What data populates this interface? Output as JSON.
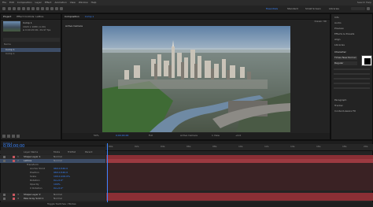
{
  "menu": {
    "items": [
      "File",
      "Edit",
      "Composition",
      "Layer",
      "Effect",
      "Animation",
      "View",
      "Window",
      "Help"
    ],
    "right": [
      "Search Help"
    ]
  },
  "workspaces": [
    "Essentials",
    "Standard",
    "Small Screen",
    "Libraries"
  ],
  "project": {
    "tab": "Project",
    "tab2": "Effect Controls: Lattice",
    "item_name": "Comp 1",
    "item_meta": "1920 x 1080 (1.00)",
    "item_meta2": "Δ 0:00:20:00, 29.97 fps",
    "columns": [
      "Name"
    ],
    "rows": [
      "Comp 1",
      "Comp 1"
    ]
  },
  "composition": {
    "tab": "Composition",
    "tab_name": "Comp 1",
    "view_label": "Active Camera",
    "renderer": "Classic 3D",
    "footer": [
      "50%",
      "0;00;00;00",
      "Full",
      "Active Camera",
      "1 View",
      "+0.0"
    ]
  },
  "right_panel": {
    "items": [
      "Info",
      "Audio",
      "Preview",
      "Effects & Presets",
      "Align",
      "Libraries",
      "Character",
      "Paragraph",
      "Tracker",
      "Content-Aware Fill"
    ],
    "font": "Times New Roman",
    "style": "Regular"
  },
  "timeline": {
    "tab": "Comp 1",
    "timecode": "0;00;00;00",
    "columns": [
      "Layer Name",
      "Mode",
      "TrkMat",
      "Parent"
    ],
    "layers": [
      {
        "num": "1",
        "name": "Shape Layer 1",
        "mode": "Normal"
      },
      {
        "num": "2",
        "name": "Lattice",
        "mode": "Normal"
      },
      {
        "num": "",
        "name": "Transform",
        "mode": ""
      },
      {
        "num": "",
        "name": "Anchor Point",
        "mode": "960.0,540.0"
      },
      {
        "num": "",
        "name": "Position",
        "mode": "960.0,540.0"
      },
      {
        "num": "",
        "name": "Scale",
        "mode": "100.0,100.0%"
      },
      {
        "num": "",
        "name": "Rotation",
        "mode": "0x+0.0°"
      },
      {
        "num": "",
        "name": "Opacity",
        "mode": "100%"
      },
      {
        "num": "",
        "name": "X Rotation",
        "mode": "0x+0.0°"
      },
      {
        "num": "3",
        "name": "Shape Layer 2",
        "mode": "Normal"
      },
      {
        "num": "4",
        "name": "Pale Gray Solid 1",
        "mode": "Normal"
      }
    ],
    "ruler": [
      "00s",
      "02s",
      "04s",
      "06s",
      "08s",
      "10s",
      "12s",
      "14s",
      "16s",
      "18s",
      "20s"
    ],
    "footer": "Toggle Switches / Modes"
  },
  "colors": {
    "accent": "#3b86ff",
    "track_red": "#8a2f35",
    "selected": "#3d4d66"
  }
}
